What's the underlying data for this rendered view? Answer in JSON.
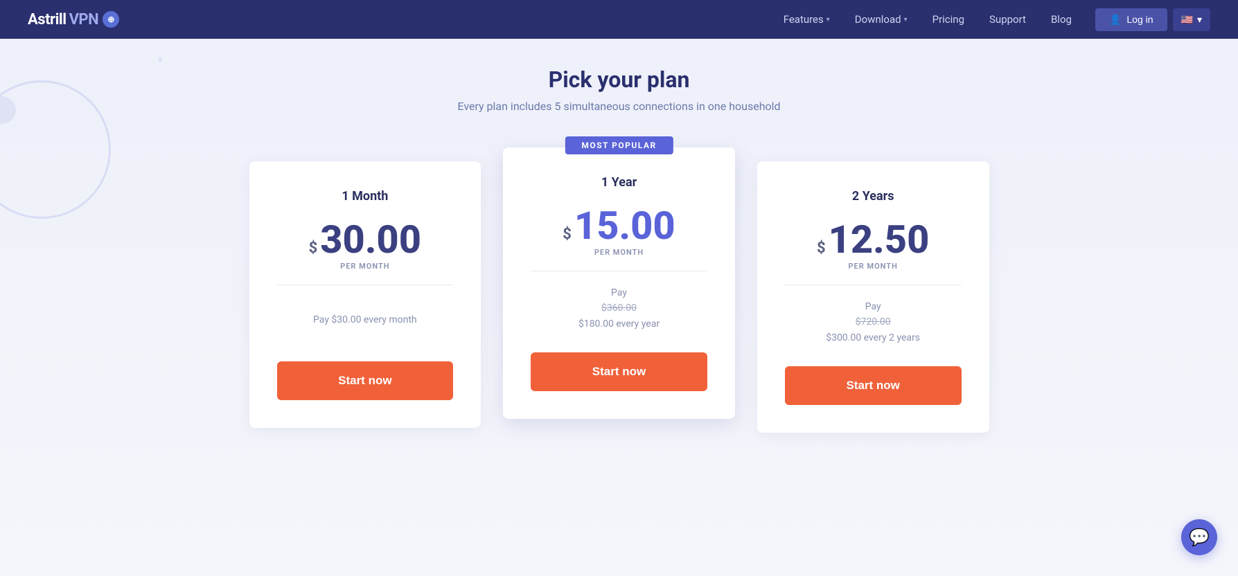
{
  "nav": {
    "logo_astrill": "Astrill",
    "logo_vpn": "VPN",
    "links": [
      {
        "label": "Features",
        "has_dropdown": true
      },
      {
        "label": "Download",
        "has_dropdown": true
      },
      {
        "label": "Pricing",
        "has_dropdown": false
      },
      {
        "label": "Support",
        "has_dropdown": false
      },
      {
        "label": "Blog",
        "has_dropdown": false
      }
    ],
    "login_label": "Log in",
    "flag_emoji": "🇺🇸"
  },
  "page": {
    "subtitle": "Pick your plan",
    "tagline": "Every plan includes 5 simultaneous connections in one household"
  },
  "plans": [
    {
      "id": "1month",
      "title": "1 Month",
      "price_dollar": "$",
      "price_amount": "30.00",
      "price_period": "PER MONTH",
      "billing_line1": "Pay $30.00 every month",
      "billing_line2": "",
      "billing_strikethrough": "",
      "is_featured": false,
      "cta": "Start now"
    },
    {
      "id": "1year",
      "title": "1 Year",
      "price_dollar": "$",
      "price_amount": "15.00",
      "price_period": "PER MONTH",
      "billing_line1": "Pay",
      "billing_strikethrough": "$360.00",
      "billing_line2": "$180.00 every year",
      "is_featured": true,
      "badge": "MOST POPULAR",
      "cta": "Start now"
    },
    {
      "id": "2years",
      "title": "2 Years",
      "price_dollar": "$",
      "price_amount": "12.50",
      "price_period": "PER MONTH",
      "billing_line1": "Pay",
      "billing_strikethrough": "$720.00",
      "billing_line2": "$300.00 every 2 years",
      "is_featured": false,
      "cta": "Start now"
    }
  ],
  "chat": {
    "icon": "💬"
  }
}
